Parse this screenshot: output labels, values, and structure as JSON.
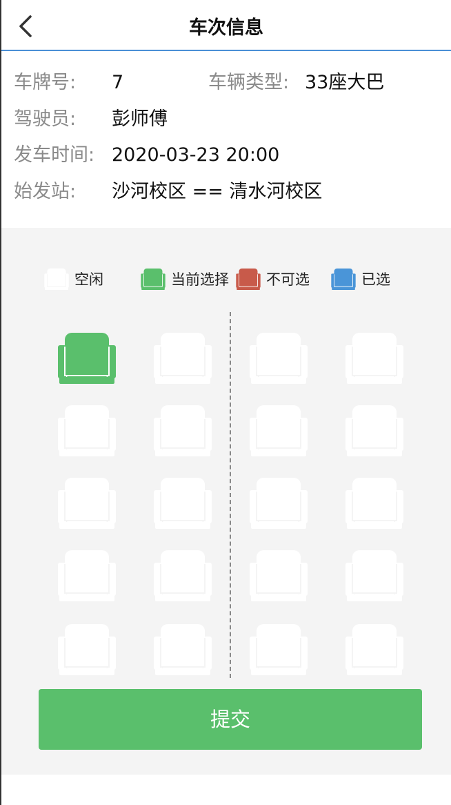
{
  "header": {
    "title": "车次信息"
  },
  "info": {
    "plate_label": "车牌号:",
    "plate_value": "7",
    "type_label": "车辆类型:",
    "type_value": "33座大巴",
    "driver_label": "驾驶员:",
    "driver_value": "彭师傅",
    "time_label": "发车时间:",
    "time_value": "2020-03-23 20:00",
    "station_label": "始发站:",
    "station_value": "沙河校区 == 清水河校区"
  },
  "legend": [
    {
      "label": "空闲",
      "color": "#ffffff"
    },
    {
      "label": "当前选择",
      "color": "#5abf6c"
    },
    {
      "label": "不可选",
      "color": "#c85a4a"
    },
    {
      "label": "已选",
      "color": "#4a95d8"
    }
  ],
  "seats": {
    "rows": 5,
    "columns": 4,
    "status": [
      [
        "current",
        "free",
        "free",
        "free"
      ],
      [
        "free",
        "free",
        "free",
        "free"
      ],
      [
        "free",
        "free",
        "free",
        "free"
      ],
      [
        "free",
        "free",
        "free",
        "free"
      ],
      [
        "free",
        "free",
        "free",
        "free"
      ]
    ],
    "status_colors": {
      "free": "#ffffff",
      "current": "#5abf6c",
      "unavailable": "#c85a4a",
      "selected": "#4a95d8"
    }
  },
  "submit": {
    "label": "提交"
  },
  "colors": {
    "accent": "#4a8fd6",
    "primary_button": "#5abf6c",
    "seat_bg": "#f4f4f4"
  }
}
